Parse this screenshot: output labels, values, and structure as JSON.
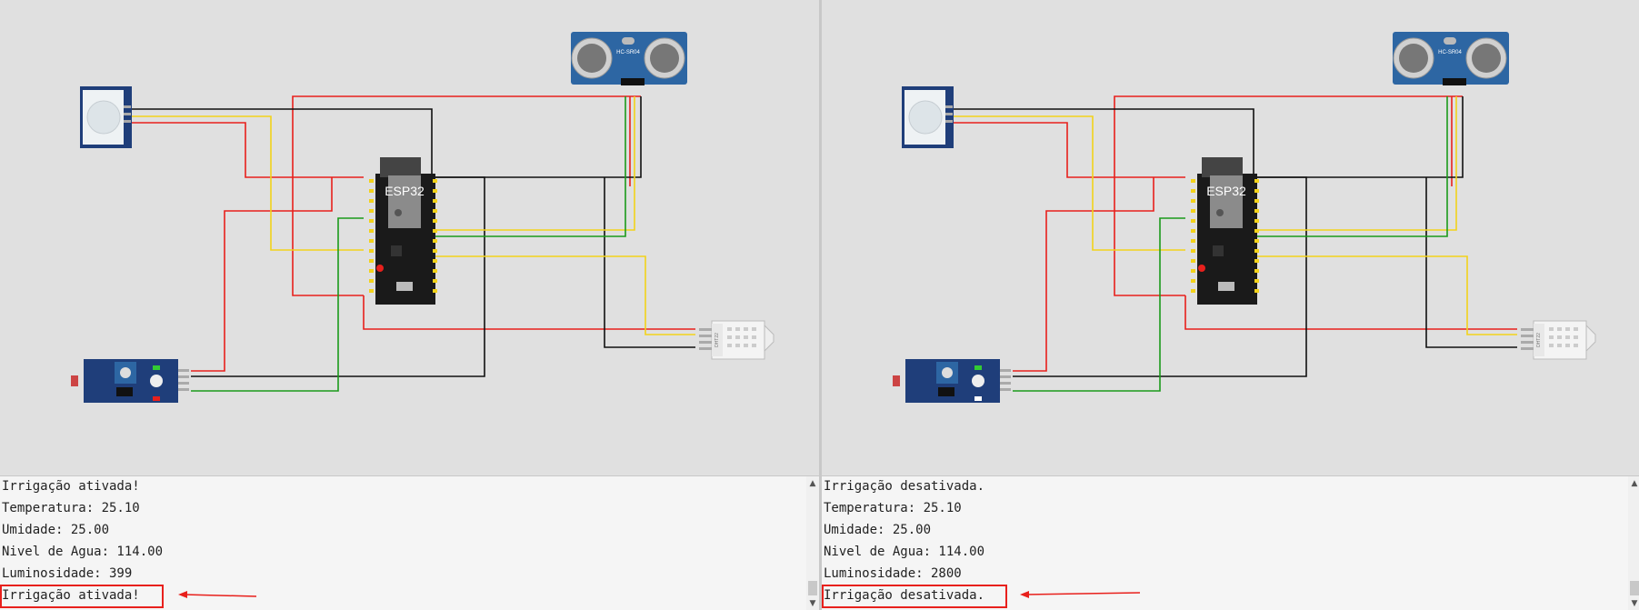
{
  "panels": [
    {
      "console": {
        "lines": [
          "Irrigação ativada!",
          "Temperatura: 25.10",
          "Umidade: 25.00",
          "Nivel de Agua: 114.00",
          "Luminosidade: 399",
          "Irrigação ativada!"
        ]
      },
      "ldr_on": true
    },
    {
      "console": {
        "lines": [
          "Irrigação desativada.",
          "Temperatura: 25.10",
          "Umidade: 25.00",
          "Nivel de Agua: 114.00",
          "Luminosidade: 2800",
          "Irrigação desativada."
        ]
      },
      "ldr_on": false
    }
  ],
  "components": {
    "esp32_label": "ESP32",
    "ultrasonic_label": "HC-SR04",
    "dht_label": "DHT22"
  },
  "colors": {
    "canvas_bg": "#e0e0e0",
    "wire_red": "#e8201c",
    "wire_black": "#111111",
    "wire_yellow": "#f2d21a",
    "wire_green": "#1a9a1a",
    "board_blue": "#1f3e7a",
    "highlight": "#e8201c"
  }
}
